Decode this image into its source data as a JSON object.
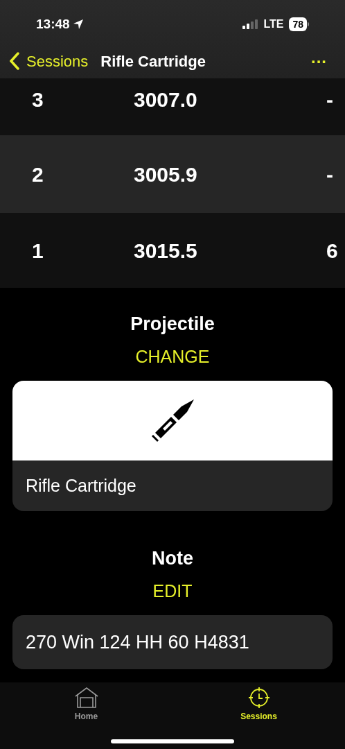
{
  "status_bar": {
    "time": "13:48",
    "network": "LTE",
    "battery": "78"
  },
  "nav": {
    "back": "Sessions",
    "title": "Rifle Cartridge",
    "more": "..."
  },
  "shots": [
    {
      "column_1": "3",
      "column_2": "3007.0",
      "column_3": "-"
    },
    {
      "column_1": "2",
      "column_2": "3005.9",
      "column_3": "-"
    },
    {
      "column_1": "1",
      "column_2": "3015.5",
      "column_3": "6"
    }
  ],
  "projectile": {
    "heading": "Projectile",
    "action": "CHANGE",
    "name": "Rifle Cartridge"
  },
  "note": {
    "heading": "Note",
    "action": "EDIT",
    "text": "270 Win 124 HH 60 H4831"
  },
  "tab_bar": [
    {
      "label": "Home",
      "kind": "home",
      "selected": false
    },
    {
      "label": "Sessions",
      "kind": "sessions",
      "selected": true
    }
  ]
}
